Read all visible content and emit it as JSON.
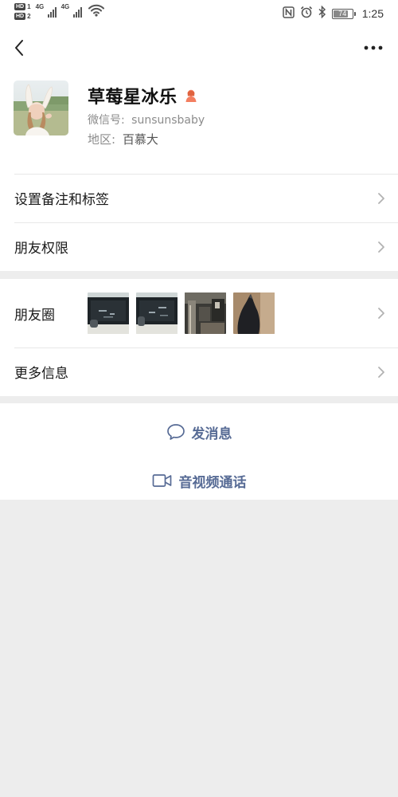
{
  "status_bar": {
    "sim1": "HD",
    "sim1_slot": "1",
    "sim2": "HD",
    "sim2_slot": "2",
    "network1": "4G",
    "network2": "4G",
    "battery_level": "74",
    "time": "1:25"
  },
  "nav": {
    "back_icon": "chevron-left-icon",
    "more_icon": "ellipsis-icon"
  },
  "profile": {
    "nickname": "草莓星冰乐",
    "gender_icon": "female-icon",
    "gender_color": "#f37e60",
    "wechat_id_label": "微信号:",
    "wechat_id": "sunsunsbaby",
    "region_label": "地区:",
    "region": "百慕大"
  },
  "rows": {
    "remark": "设置备注和标签",
    "permissions": "朋友权限",
    "moments": "朋友圈",
    "more_info": "更多信息"
  },
  "actions": {
    "send_message": "发消息",
    "video_call": "音视频通话",
    "link_color": "#576b95"
  }
}
